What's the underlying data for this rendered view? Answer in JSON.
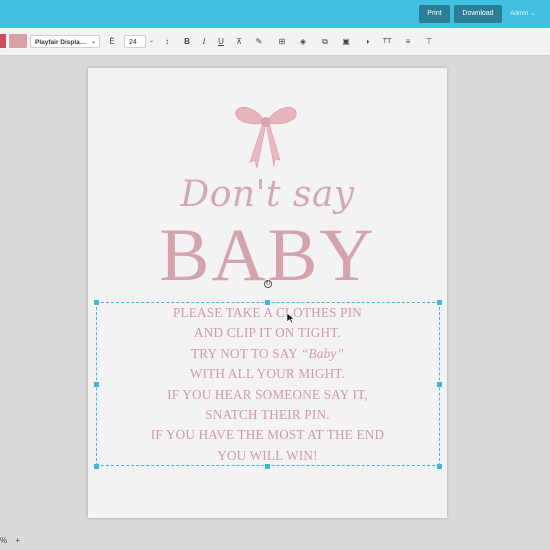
{
  "topbar": {
    "print_label": "Print",
    "download_label": "Download",
    "user_label": "Admin ⌄"
  },
  "toolbar": {
    "font_name": "Playfair Displa…",
    "font_size": "24",
    "bold_glyph": "B",
    "italic_glyph": "I",
    "underline_glyph": "U",
    "tt_glyph": "TT"
  },
  "document": {
    "heading_script": "Don't say",
    "heading_main": "BABY",
    "rules": [
      "PLEASE TAKE A CLOTHES PIN",
      "AND CLIP IT ON TIGHT.",
      "TRY NOT TO SAY",
      "“Baby”",
      "WITH ALL YOUR MIGHT.",
      "IF YOU HEAR SOMEONE SAY IT,",
      "SNATCH THEIR PIN.",
      "IF YOU HAVE THE MOST AT THE END",
      "YOU WILL WIN!"
    ]
  },
  "statusbar": {
    "zoom_suffix": "%",
    "plus": "+"
  },
  "colors": {
    "header": "#41bfe0",
    "text_pink": "#cf9aa4",
    "selection": "#41b6e0"
  }
}
